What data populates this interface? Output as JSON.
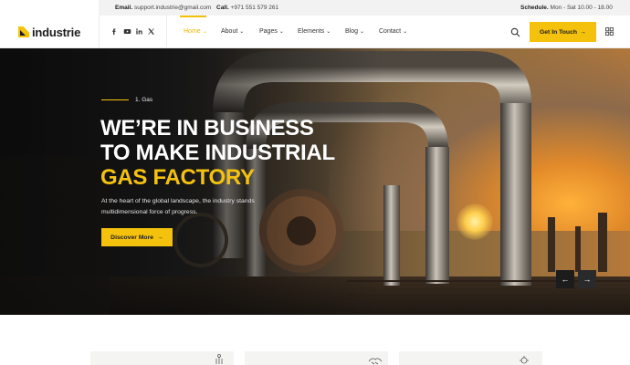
{
  "topbar": {
    "email_label": "Email.",
    "email_value": "support.industrie@gmail.com",
    "call_label": "Call.",
    "call_value": "+971 551 579 261",
    "schedule_label": "Schedule.",
    "schedule_value": "Mon - Sat 10.00 - 18.00"
  },
  "header": {
    "logo_text": "industrie",
    "social": [
      "facebook-icon",
      "youtube-icon",
      "linkedin-icon",
      "x-icon"
    ],
    "nav": [
      {
        "label": "Home",
        "active": true
      },
      {
        "label": "About",
        "active": false
      },
      {
        "label": "Pages",
        "active": false
      },
      {
        "label": "Elements",
        "active": false
      },
      {
        "label": "Blog",
        "active": false
      },
      {
        "label": "Contact",
        "active": false
      }
    ],
    "cta_label": "Get In Touch",
    "cta_arrow": "→",
    "chevron": "⌄"
  },
  "hero": {
    "eyebrow": "1. Gas",
    "title_line1": "WE’RE IN BUSINESS",
    "title_line2": "TO MAKE INDUSTRIAL",
    "title_line3": "GAS FACTORY",
    "description": "At the heart of the global landscape, the industry stands multidimensional force of progress.",
    "button_label": "Discover More",
    "button_arrow": "→",
    "prev_arrow": "←",
    "next_arrow": "→"
  },
  "colors": {
    "accent": "#f4c20d",
    "dark": "#1b1b1b",
    "topbar_bg": "#f2f2f2"
  }
}
